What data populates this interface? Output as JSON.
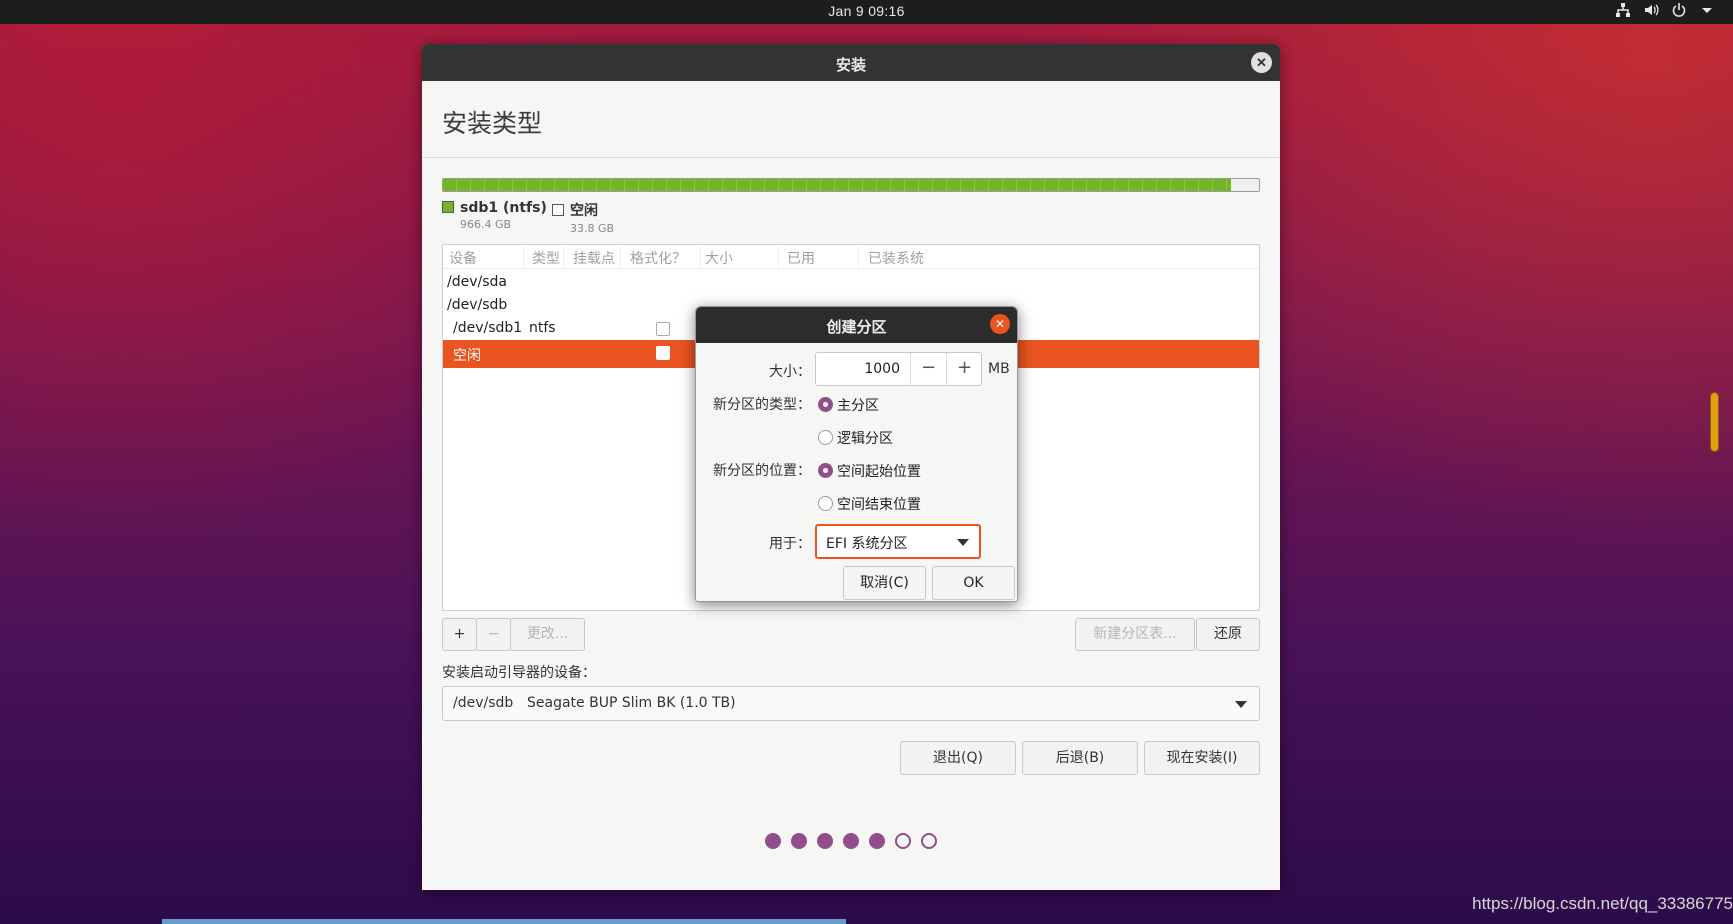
{
  "topbar": {
    "clock": "Jan 9  09:16",
    "tray_icons": [
      "network-icon",
      "volume-icon",
      "power-icon",
      "chevron-down-icon"
    ]
  },
  "window": {
    "title": "安装",
    "page_title": "安装类型"
  },
  "disk": {
    "used_fraction": 0.966,
    "colors": {
      "ntfs": "#73b526",
      "free": "#ffffff"
    },
    "legend": [
      {
        "name": "sdb1 (ntfs)",
        "size": "966.4 GB"
      },
      {
        "name": "空闲",
        "size": "33.8 GB"
      }
    ]
  },
  "table": {
    "headers": [
      "设备",
      "类型",
      "挂载点",
      "格式化？",
      "大小",
      "已用",
      "已装系统"
    ],
    "rows": [
      {
        "device": "/dev/sda",
        "type": ""
      },
      {
        "device": "/dev/sdb",
        "type": ""
      },
      {
        "device": "/dev/sdb1",
        "type": "ntfs"
      },
      {
        "device": "空闲",
        "type": ""
      }
    ]
  },
  "table_buttons": {
    "add": "+",
    "remove": "−",
    "change": "更改...",
    "new_table": "新建分区表...",
    "revert": "还原"
  },
  "boot": {
    "label": "安装启动引导器的设备：",
    "device": "/dev/sdb",
    "description": "Seagate BUP Slim BK (1.0 TB)"
  },
  "nav": {
    "quit": "退出(Q)",
    "back": "后退(B)",
    "install": "现在安装(I)"
  },
  "progress": {
    "total": 7,
    "completed": 5
  },
  "dialog": {
    "title": "创建分区",
    "size_label": "大小：",
    "size_value": "1000",
    "minus": "−",
    "plus": "+",
    "unit": "MB",
    "type_label": "新分区的类型：",
    "type_primary": "主分区",
    "type_logical": "逻辑分区",
    "location_label": "新分区的位置：",
    "location_start": "空间起始位置",
    "location_end": "空间结束位置",
    "use_label": "用于：",
    "use_value": "EFI 系统分区",
    "cancel": "取消(C)",
    "ok": "OK",
    "accent": "#e95420",
    "radio_color": "#924d8b"
  },
  "watermark": "https://blog.csdn.net/qq_33386775"
}
